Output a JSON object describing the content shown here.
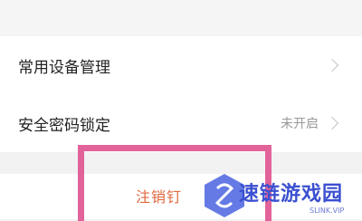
{
  "settings": {
    "items": [
      {
        "label": "常用设备管理",
        "value": ""
      },
      {
        "label": "安全密码锁定",
        "value": "未开启"
      }
    ],
    "logout_label": "注销钉"
  },
  "watermark": {
    "text": "速链游戏园",
    "sub": "SLINK.VIP",
    "icon": "s-link-logo-icon"
  },
  "colors": {
    "highlight": "#e2629a",
    "logout": "#e0683e",
    "watermark": "#3a4fd0"
  }
}
